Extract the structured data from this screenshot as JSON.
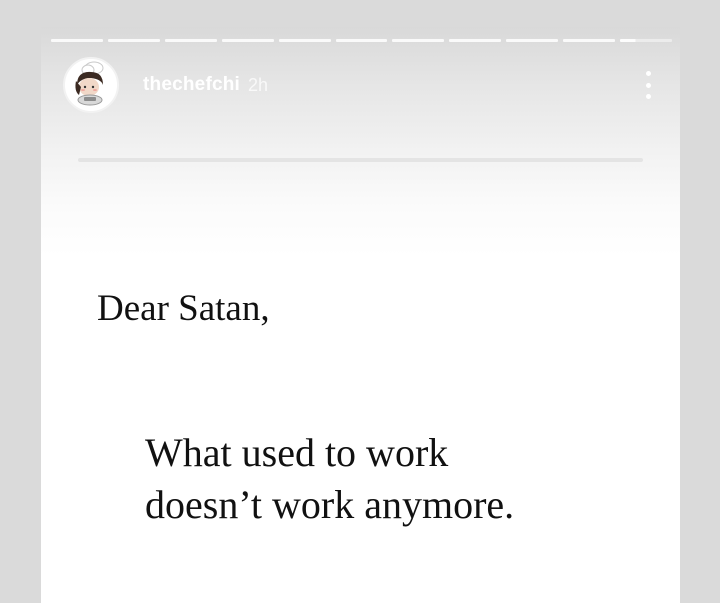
{
  "story": {
    "progress_segments": 11,
    "header": {
      "username": "thechefchi",
      "time": "2h",
      "avatar_icon": "chef-avatar-icon",
      "more_icon": "more-vertical-icon"
    },
    "body": {
      "greeting": "Dear Satan,",
      "message_lines": [
        "What used to work",
        "doesn’t work anymore."
      ]
    }
  }
}
